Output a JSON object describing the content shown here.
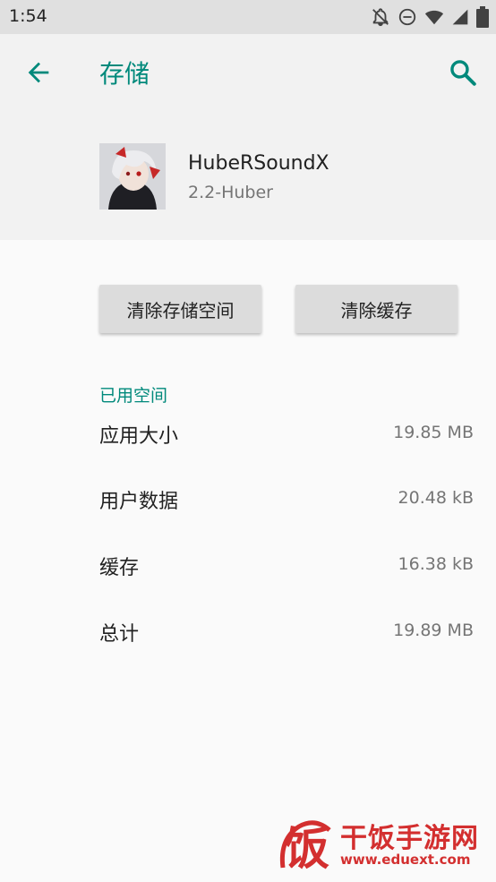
{
  "status_bar": {
    "time": "1:54",
    "icons": [
      "notifications-off-icon",
      "do-not-disturb-icon",
      "wifi-icon",
      "signal-icon",
      "battery-icon"
    ]
  },
  "app_bar": {
    "title": "存储",
    "back_icon": "arrow-back-icon",
    "search_icon": "search-icon",
    "accent_color": "#00897b"
  },
  "app": {
    "name": "HubeRSoundX",
    "version": "2.2-Huber"
  },
  "buttons": {
    "clear_storage": "清除存储空间",
    "clear_cache": "清除缓存"
  },
  "storage": {
    "section_title": "已用空间",
    "rows": [
      {
        "label": "应用大小",
        "value": "19.85 MB"
      },
      {
        "label": "用户数据",
        "value": "20.48 kB"
      },
      {
        "label": "缓存",
        "value": "16.38 kB"
      },
      {
        "label": "总计",
        "value": "19.89 MB"
      }
    ]
  },
  "watermark": {
    "glyph": "饭",
    "title": "干饭手游网",
    "url": "www.eduext.com"
  }
}
